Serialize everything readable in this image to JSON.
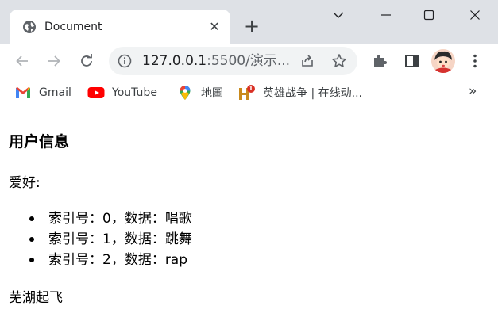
{
  "tab": {
    "title": "Document",
    "close_glyph": "✕",
    "new_tab_glyph": "+"
  },
  "window_controls": {
    "chevron": "chevron-down-icon",
    "minimize": "minimize-icon",
    "maximize": "maximize-icon",
    "close": "close-icon"
  },
  "address_bar": {
    "host": "127.0.0.1",
    "port_path": ":5500/演示..."
  },
  "bookmarks": [
    {
      "label": "Gmail",
      "icon": "gmail-icon"
    },
    {
      "label": "YouTube",
      "icon": "youtube-icon"
    },
    {
      "label": "地圖",
      "icon": "maps-icon"
    },
    {
      "label": "英雄战争 | 在线动...",
      "icon": "game-icon",
      "badge": "1"
    }
  ],
  "bookmarks_more": "»",
  "page": {
    "heading": "用户信息",
    "hobby_label": "爱好:",
    "items": [
      "索引号：0，数据：唱歌",
      "索引号：1，数据：跳舞",
      "索引号：2，数据：rap"
    ],
    "footer": "芜湖起飞"
  },
  "colors": {
    "tabstrip_bg": "#dee1e6",
    "omnibox_bg": "#f1f3f4",
    "youtube_red": "#ff0000",
    "icon_grey": "#5f6368"
  }
}
